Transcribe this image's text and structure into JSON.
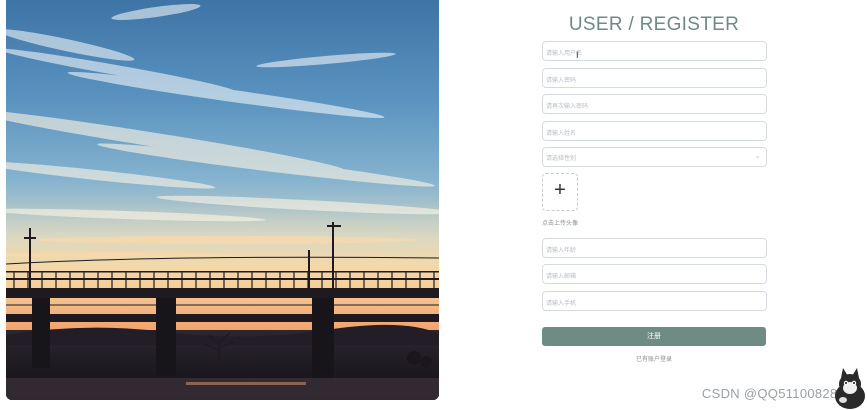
{
  "form": {
    "title": "USER / REGISTER",
    "fields": [
      {
        "placeholder": "请输入用户名"
      },
      {
        "placeholder": "请输入密码"
      },
      {
        "placeholder": "请再次输入密码"
      },
      {
        "placeholder": "请输入姓名"
      }
    ],
    "select": {
      "placeholder": "请选择性别"
    },
    "upload": {
      "icon": "+",
      "label": "点击上传头像"
    },
    "fields2": [
      {
        "placeholder": "请输入年龄"
      },
      {
        "placeholder": "请输入邮箱"
      },
      {
        "placeholder": "请输入手机"
      }
    ],
    "submit_label": "注册",
    "login_link": "已有账户登录",
    "cursor": "I"
  },
  "watermark": {
    "text": "CSDN @QQ511008285"
  },
  "colors": {
    "accent": "#6f8c84",
    "title": "#6f8a85",
    "border": "#d6dbe0"
  }
}
